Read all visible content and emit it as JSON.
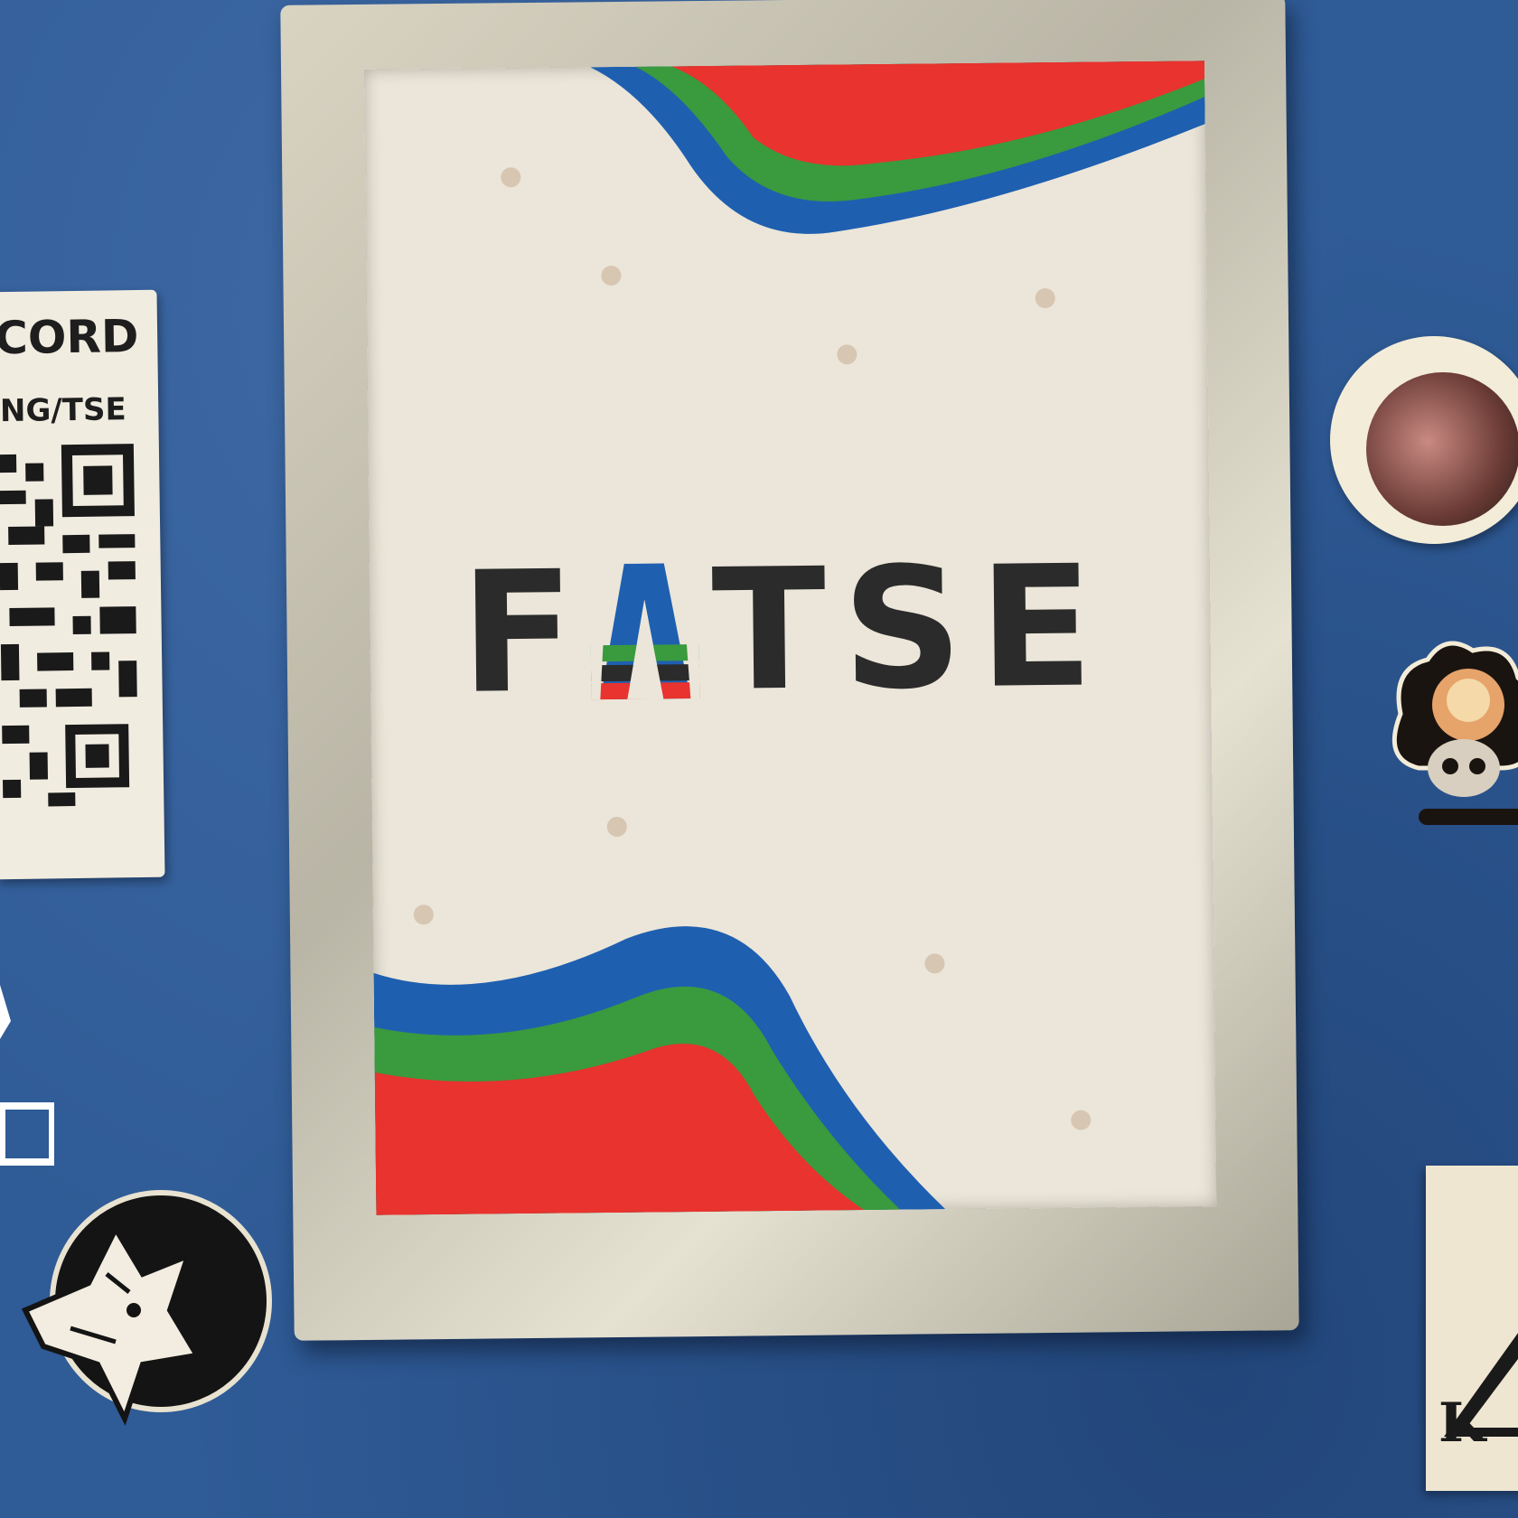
{
  "poster": {
    "title_letters": [
      "F",
      "A",
      "T",
      "S",
      "E"
    ],
    "colors": {
      "wall": "#2f5b96",
      "paper": "#ebe6d9",
      "wave_red": "#e8332e",
      "wave_green": "#3a9a3e",
      "wave_blue": "#1f5fb0",
      "ink": "#2b2b2b"
    }
  },
  "qr_sticker": {
    "line1": "CORD",
    "line2": "ING/TSE"
  },
  "side_stickers": {
    "corner_letter": "K"
  }
}
